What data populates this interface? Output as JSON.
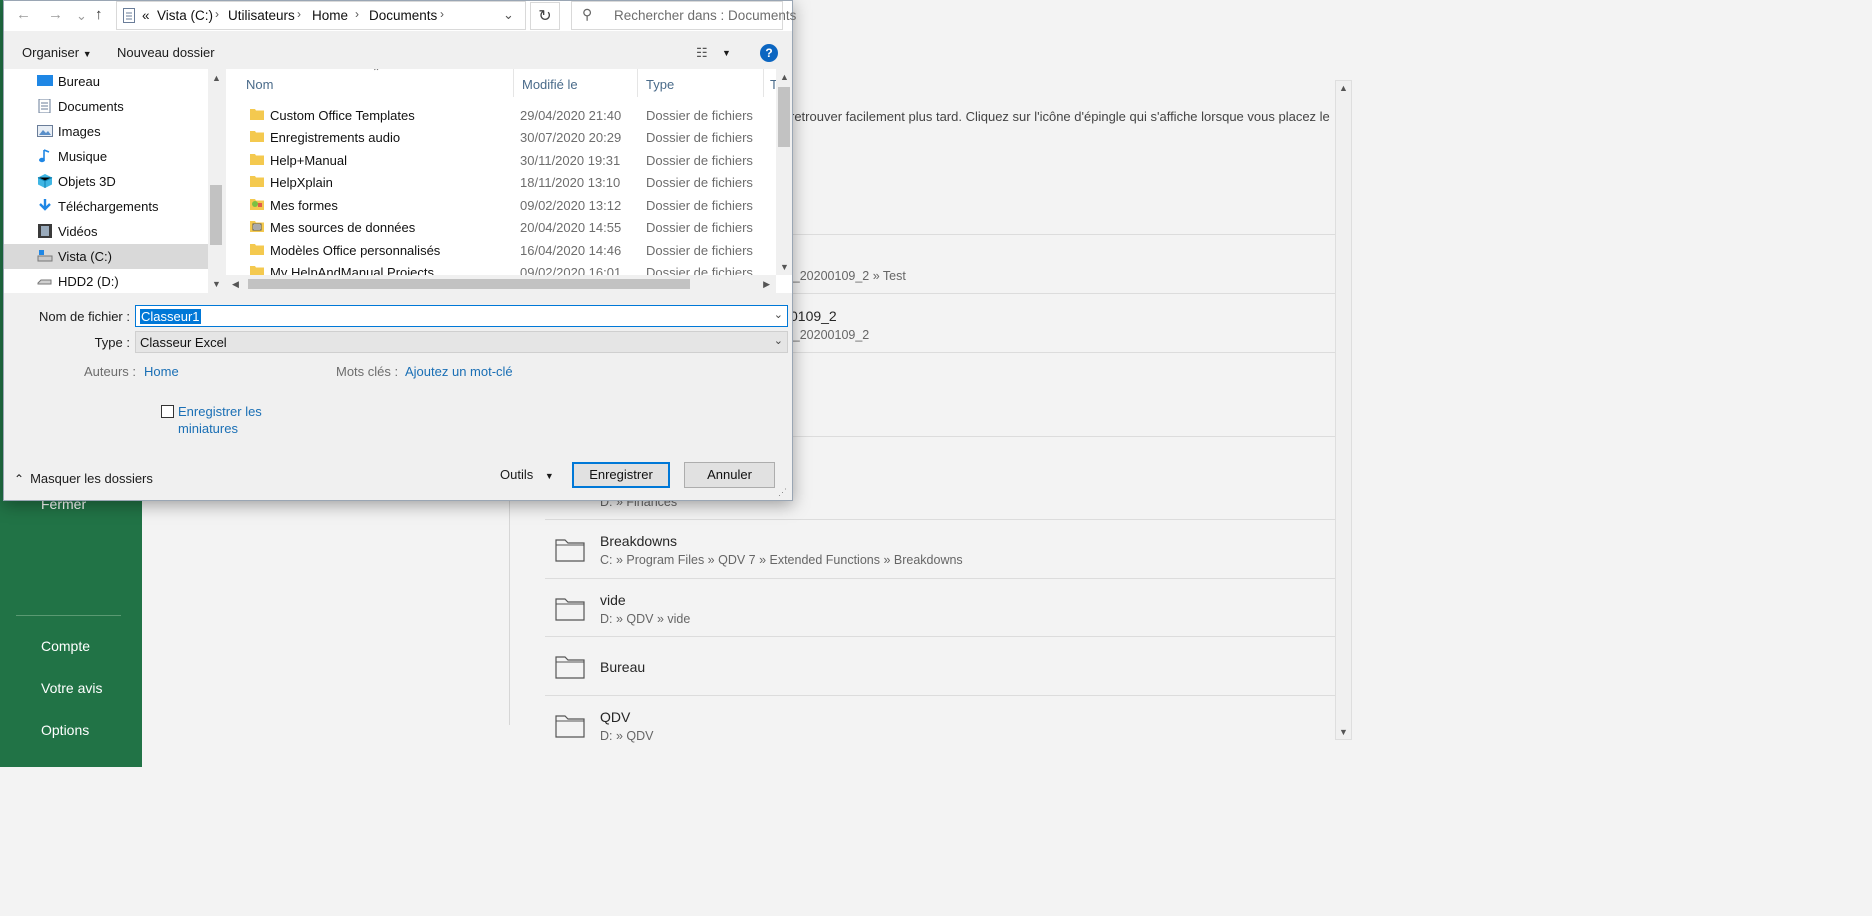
{
  "backstage": {
    "sidebar": {
      "fermer": "Fermer",
      "compte": "Compte",
      "avis": "Votre avis",
      "options": "Options"
    },
    "intro": "retrouver facilement plus tard. Cliquez sur l'icône d'épingle qui s'affiche lorsque vous placez le",
    "partial_rows": [
      {
        "path": "l_20200109_2 » Test"
      },
      {
        "name": "0109_2",
        "path": "l_20200109_2"
      },
      {
        "path": "D: » Finances"
      }
    ],
    "rows": [
      {
        "name": "Breakdowns",
        "path": "C: » Program Files » QDV 7 » Extended Functions » Breakdowns"
      },
      {
        "name": "vide",
        "path": "D: » QDV » vide"
      },
      {
        "name": "Bureau",
        "path": ""
      },
      {
        "name": "QDV",
        "path": "D: » QDV"
      }
    ]
  },
  "dialog": {
    "address": {
      "overflow": "«",
      "segments": [
        "Vista (C:)",
        "Utilisateurs",
        "Home",
        "Documents"
      ]
    },
    "search_placeholder": "Rechercher dans : Documents",
    "toolbar": {
      "organize": "Organiser",
      "new_folder": "Nouveau dossier",
      "help": "?"
    },
    "nav_items": [
      {
        "label": "Bureau",
        "icon": "desktop-icon"
      },
      {
        "label": "Documents",
        "icon": "documents-icon"
      },
      {
        "label": "Images",
        "icon": "images-icon"
      },
      {
        "label": "Musique",
        "icon": "music-icon"
      },
      {
        "label": "Objets 3D",
        "icon": "3d-objects-icon"
      },
      {
        "label": "Téléchargements",
        "icon": "downloads-icon"
      },
      {
        "label": "Vidéos",
        "icon": "videos-icon"
      },
      {
        "label": "Vista (C:)",
        "icon": "drive-c-icon",
        "selected": true
      },
      {
        "label": "HDD2 (D:)",
        "icon": "drive-d-icon"
      }
    ],
    "columns": {
      "name": "Nom",
      "modified": "Modifié le",
      "type": "Type",
      "size": "T"
    },
    "files": [
      {
        "name": "Custom Office Templates",
        "modified": "29/04/2020 21:40",
        "type": "Dossier de fichiers"
      },
      {
        "name": "Enregistrements audio",
        "modified": "30/07/2020 20:29",
        "type": "Dossier de fichiers"
      },
      {
        "name": "Help+Manual",
        "modified": "30/11/2020 19:31",
        "type": "Dossier de fichiers"
      },
      {
        "name": "HelpXplain",
        "modified": "18/11/2020 13:10",
        "type": "Dossier de fichiers"
      },
      {
        "name": "Mes formes",
        "modified": "09/02/2020 13:12",
        "type": "Dossier de fichiers"
      },
      {
        "name": "Mes sources de données",
        "modified": "20/04/2020 14:55",
        "type": "Dossier de fichiers"
      },
      {
        "name": "Modèles Office personnalisés",
        "modified": "16/04/2020 14:46",
        "type": "Dossier de fichiers"
      },
      {
        "name": "My HelpAndManual Projects",
        "modified": "09/02/2020 16:01",
        "type": "Dossier de fichiers"
      }
    ],
    "filename_label": "Nom de fichier :",
    "filename_value": "Classeur1",
    "type_label": "Type :",
    "type_value": "Classeur Excel",
    "authors_label": "Auteurs :",
    "authors_value": "Home",
    "keywords_label": "Mots clés :",
    "keywords_value": "Ajoutez un mot-clé",
    "thumbnails_label": "Enregistrer les miniatures",
    "hide_folders": "Masquer les dossiers",
    "tools": "Outils",
    "save": "Enregistrer",
    "cancel": "Annuler"
  }
}
